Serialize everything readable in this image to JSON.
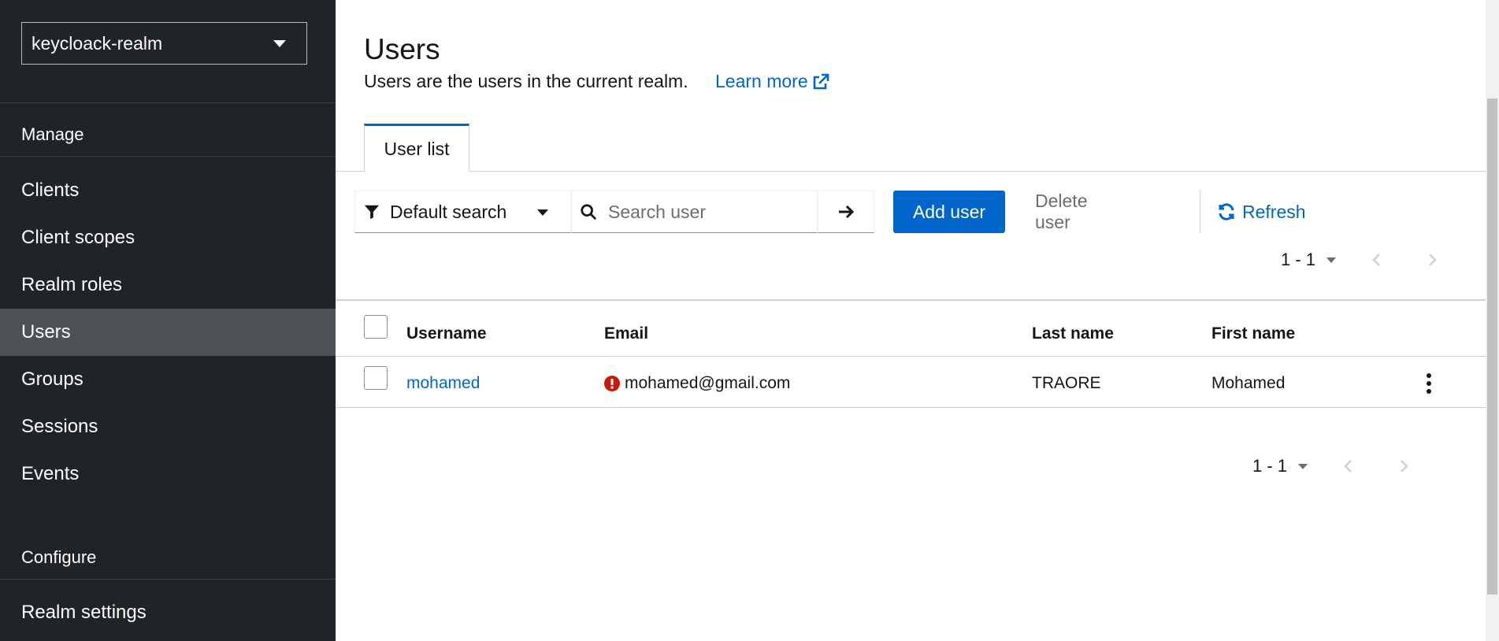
{
  "sidebar": {
    "realm": "keycloack-realm",
    "manage_heading": "Manage",
    "manage_items": [
      "Clients",
      "Client scopes",
      "Realm roles",
      "Users",
      "Groups",
      "Sessions",
      "Events"
    ],
    "active_item": "Users",
    "configure_heading": "Configure",
    "configure_items": [
      "Realm settings"
    ]
  },
  "header": {
    "title": "Users",
    "description": "Users are the users in the current realm.",
    "learn_more": "Learn more"
  },
  "tabs": [
    {
      "label": "User list",
      "active": true
    }
  ],
  "toolbar": {
    "filter_label": "Default search",
    "search_placeholder": "Search user",
    "add_label": "Add user",
    "delete_label": "Delete user",
    "refresh_label": "Refresh"
  },
  "pagination": {
    "range": "1 - 1"
  },
  "table": {
    "columns": [
      "Username",
      "Email",
      "Last name",
      "First name"
    ],
    "rows": [
      {
        "username": "mohamed",
        "email": "mohamed@gmail.com",
        "email_unverified": true,
        "last_name": "TRAORE",
        "first_name": "Mohamed"
      }
    ]
  },
  "colors": {
    "accent": "#0066cc",
    "sidebar_bg": "#212427",
    "active_nav": "#4f5255",
    "warning": "#c9190b"
  }
}
